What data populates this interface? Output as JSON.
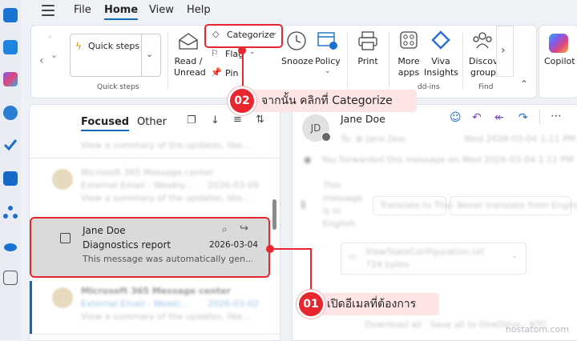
{
  "menu": {
    "items": [
      "File",
      "Home",
      "View",
      "Help"
    ],
    "active": "Home"
  },
  "ribbon": {
    "quick_steps_button": "Quick steps",
    "quick_steps_group": "Quick steps",
    "read_unread": [
      "Read /",
      "Unread"
    ],
    "categorize": "Categorize",
    "flag": "Flag",
    "pin": "Pin",
    "snooze": "Snooze",
    "policy": "Policy",
    "print": "Print",
    "more_apps": [
      "More",
      "apps"
    ],
    "viva_insights": [
      "Viva",
      "Insights"
    ],
    "addins_group": "dd-ins",
    "discover": [
      "Discov",
      "group"
    ],
    "find_group": "Find",
    "copilot": "Copilot"
  },
  "list": {
    "tabs": [
      "Focused",
      "Other"
    ],
    "items_blurred": [
      {
        "preview": "View a summary of the updates, like..."
      },
      {
        "sender": "Microsoft 365 Message center",
        "subject": "External Email - Weekly...",
        "date": "2026-03-09",
        "preview": "View a summary of the updates, like..."
      },
      {
        "sender": "Microsoft 365 Message center",
        "subject": "External Email - Weekl...",
        "date": "2026-03-02",
        "preview": "View a summary of the updates, like..."
      }
    ],
    "selected": {
      "sender": "Jane Doe",
      "subject": "Diagnostics report",
      "date": "2026-03-04",
      "preview": "This message was automatically gen..."
    }
  },
  "reading": {
    "avatar_initials": "JD",
    "sender": "Jane Doe",
    "to_line": "To: ⊕ Jane Doe",
    "date_line": "Wed 2026-03-04 1:11 PM",
    "forwarded": "You forwarded this message on Wed 2026-03-04 1:11 PM",
    "body_lines": [
      "This",
      "message",
      "is in",
      "English"
    ],
    "translate_to": "Translate to Thai",
    "never_translate": "Never translate from English",
    "attachment_name": "ViewStateConfiguration.txt",
    "attachment_size": "724 bytes",
    "footer_blur": "Download all · Save all to OneDrive - NTC"
  },
  "callouts": [
    {
      "number": "02",
      "text": "จากนั้น คลิกที่ Categorize"
    },
    {
      "number": "01",
      "text": "เปิดอีเมลที่ต้องการ"
    }
  ],
  "watermark": "hostatom.com",
  "colors": {
    "accent": "#0f6cbd",
    "highlight": "#e8262f",
    "bubble": "#fde5e6"
  }
}
